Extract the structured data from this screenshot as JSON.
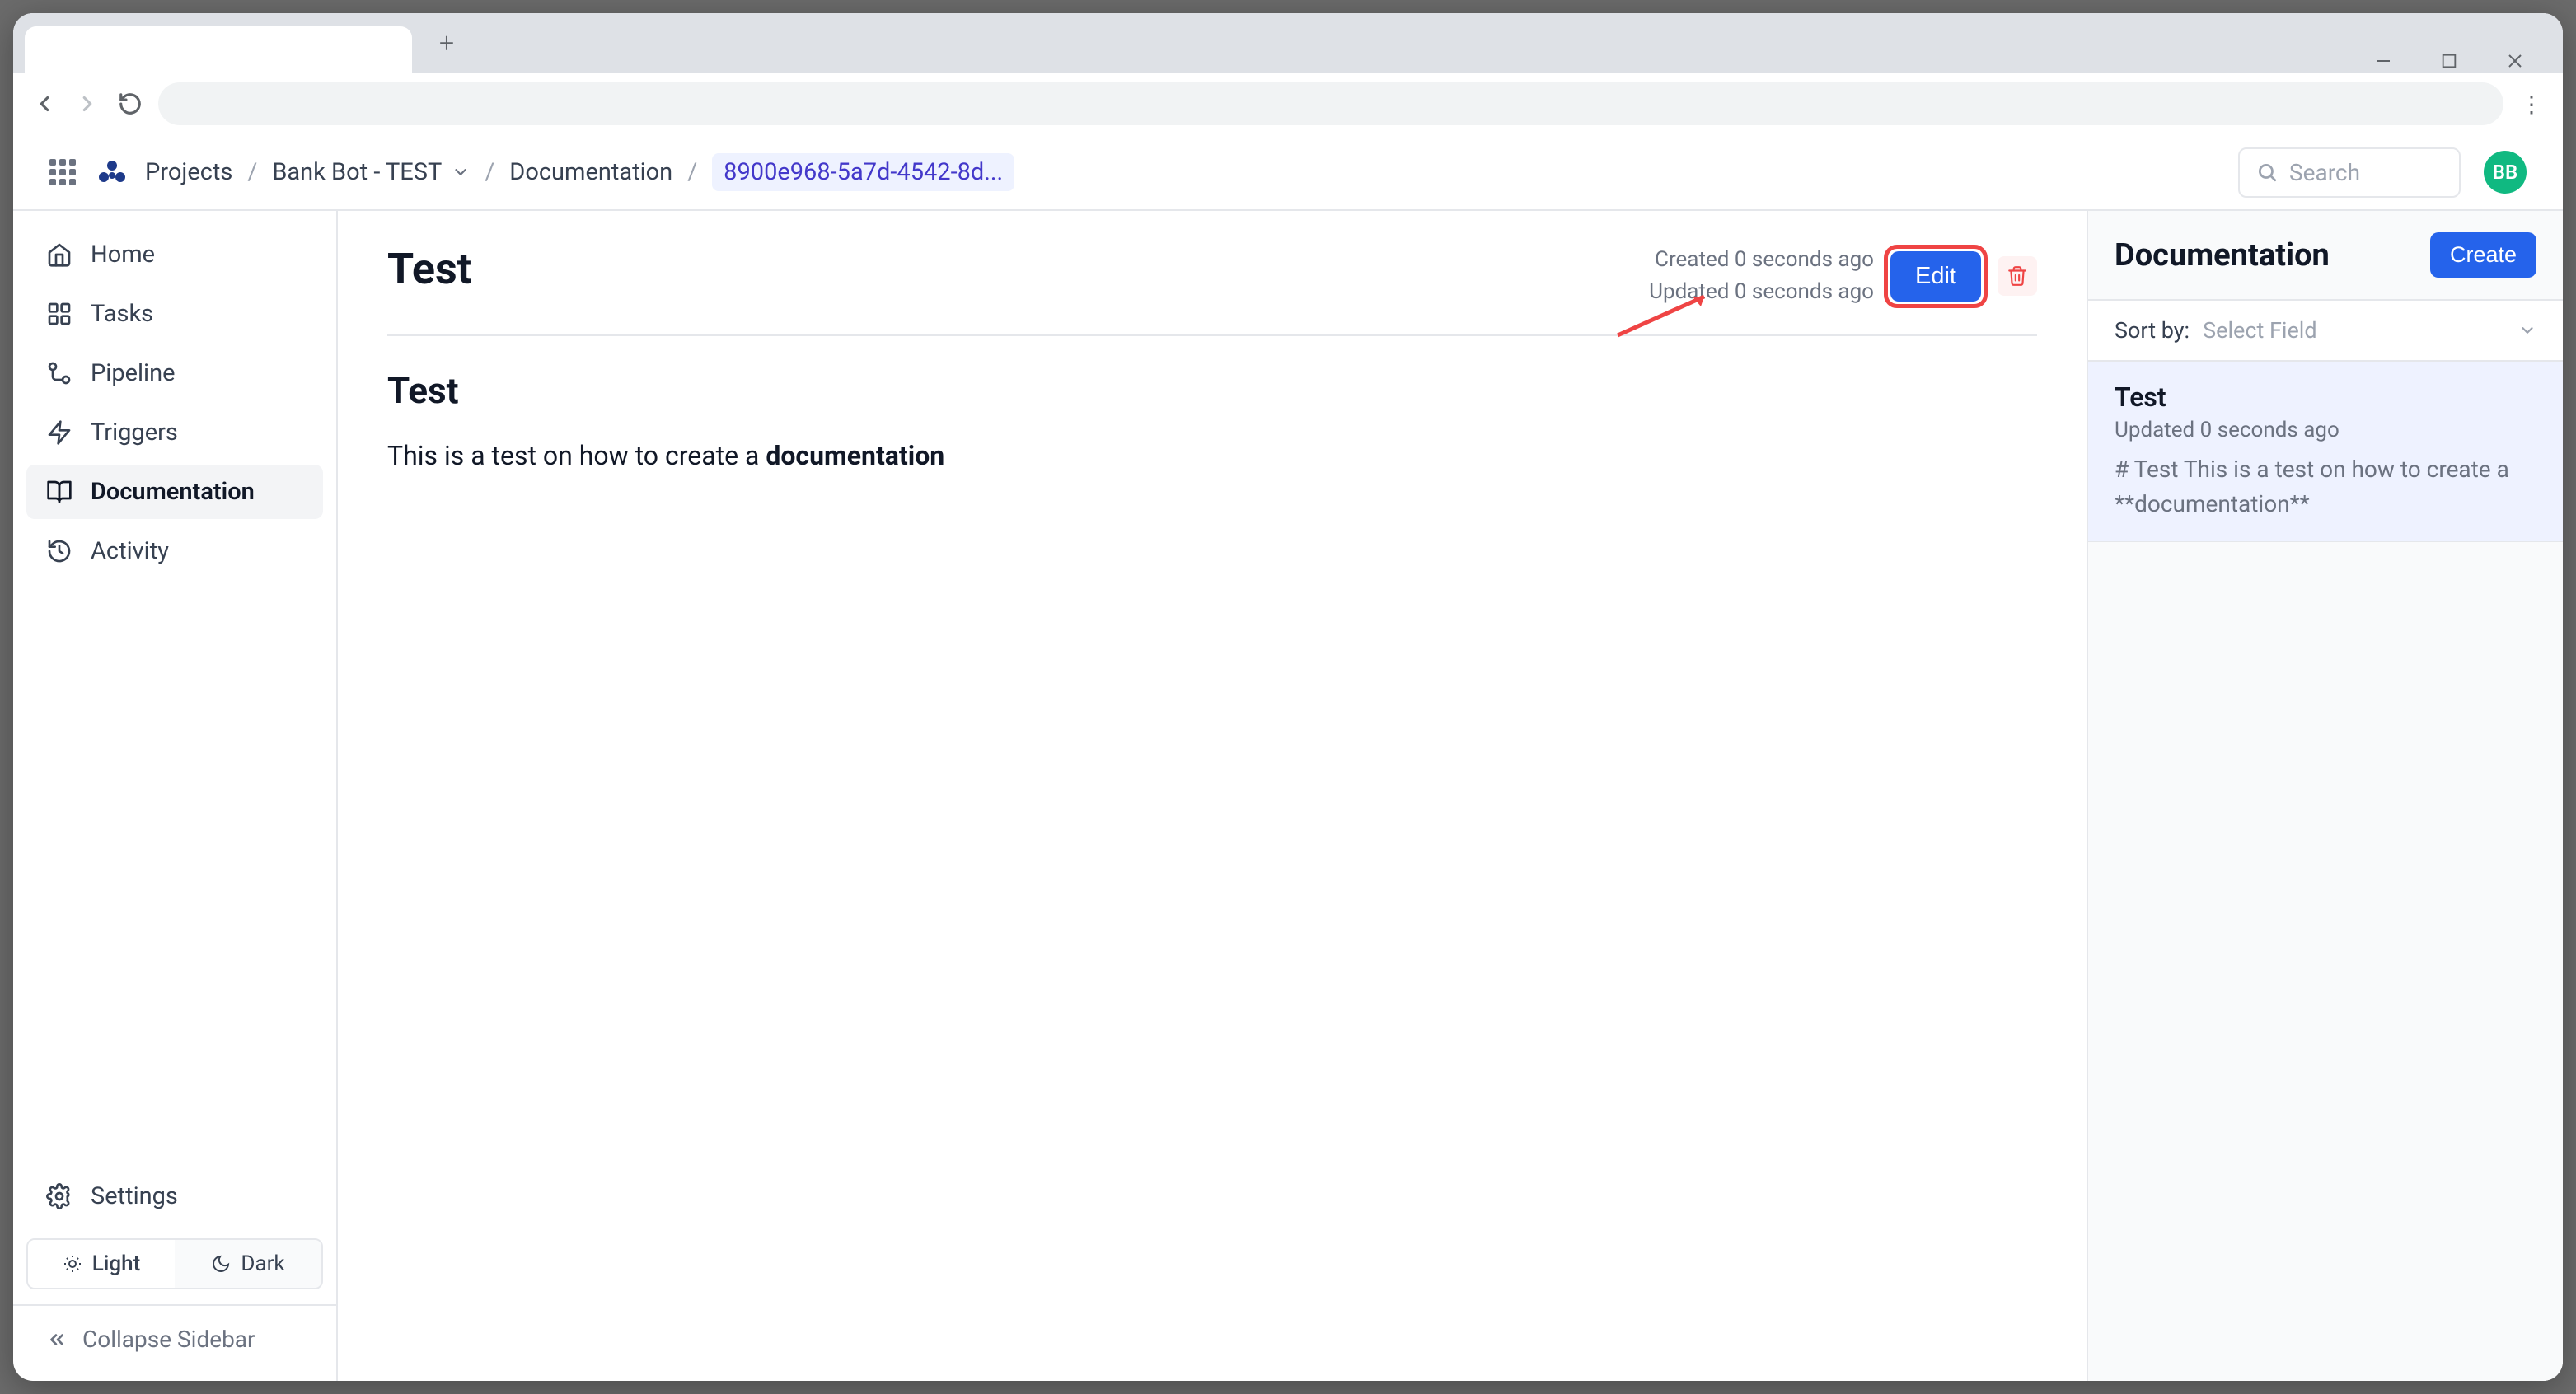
{
  "breadcrumbs": {
    "projects": "Projects",
    "project_name": "Bank Bot - TEST",
    "section": "Documentation",
    "doc_id": "8900e968-5a7d-4542-8d..."
  },
  "search": {
    "placeholder": "Search"
  },
  "avatar_initials": "BB",
  "sidebar": {
    "items": [
      {
        "label": "Home"
      },
      {
        "label": "Tasks"
      },
      {
        "label": "Pipeline"
      },
      {
        "label": "Triggers"
      },
      {
        "label": "Documentation"
      },
      {
        "label": "Activity"
      }
    ],
    "settings_label": "Settings",
    "theme": {
      "light": "Light",
      "dark": "Dark"
    },
    "collapse_label": "Collapse Sidebar"
  },
  "doc": {
    "title": "Test",
    "created": "Created 0 seconds ago",
    "updated": "Updated 0 seconds ago",
    "edit_label": "Edit",
    "body_heading": "Test",
    "body_text_prefix": "This is a test on how to create a ",
    "body_text_bold": "documentation"
  },
  "right_panel": {
    "title": "Documentation",
    "create_label": "Create",
    "sort_label": "Sort by:",
    "sort_placeholder": "Select Field",
    "cards": [
      {
        "title": "Test",
        "updated": "Updated 0 seconds ago",
        "preview": "# Test This is a test on how to create a **documentation**"
      }
    ]
  }
}
